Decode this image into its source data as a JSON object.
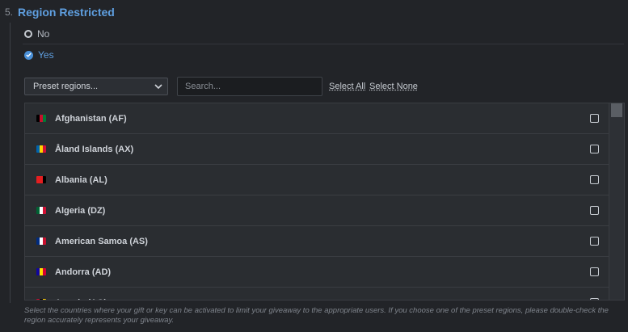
{
  "section": {
    "number": "5.",
    "title": "Region Restricted"
  },
  "options": [
    {
      "label": "No",
      "selected": false
    },
    {
      "label": "Yes",
      "selected": true
    }
  ],
  "controls": {
    "preset_label": "Preset regions...",
    "search_placeholder": "Search...",
    "select_all": "Select All",
    "select_none": "Select None"
  },
  "countries": [
    {
      "name": "Afghanistan (AF)",
      "flag": "af-flag-icon",
      "colors": [
        "#000000",
        "#c8102e",
        "#007a36"
      ],
      "checked": false
    },
    {
      "name": "Åland Islands (AX)",
      "flag": "ax-flag-icon",
      "colors": [
        "#0064ad",
        "#ffd300",
        "#d21034"
      ],
      "checked": false
    },
    {
      "name": "Albania (AL)",
      "flag": "al-flag-icon",
      "colors": [
        "#e41e20",
        "#e41e20",
        "#000000"
      ],
      "checked": false
    },
    {
      "name": "Algeria (DZ)",
      "flag": "dz-flag-icon",
      "colors": [
        "#006233",
        "#ffffff",
        "#d21034"
      ],
      "checked": false
    },
    {
      "name": "American Samoa (AS)",
      "flag": "as-flag-icon",
      "colors": [
        "#002b7f",
        "#ffffff",
        "#c8102e"
      ],
      "checked": false
    },
    {
      "name": "Andorra (AD)",
      "flag": "ad-flag-icon",
      "colors": [
        "#10069f",
        "#fedf00",
        "#d50032"
      ],
      "checked": false
    },
    {
      "name": "Angola (AO)",
      "flag": "ao-flag-icon",
      "colors": [
        "#cc092f",
        "#000000",
        "#ffcb00"
      ],
      "checked": false
    }
  ],
  "helper_text": "Select the countries where your gift or key can be activated to limit your giveaway to the appropriate users. If you choose one of the preset regions, please double-check the region accurately represents your giveaway.",
  "colors": {
    "accent": "#5f9fe0",
    "background": "#222428",
    "list_bg": "#2a2d31"
  }
}
